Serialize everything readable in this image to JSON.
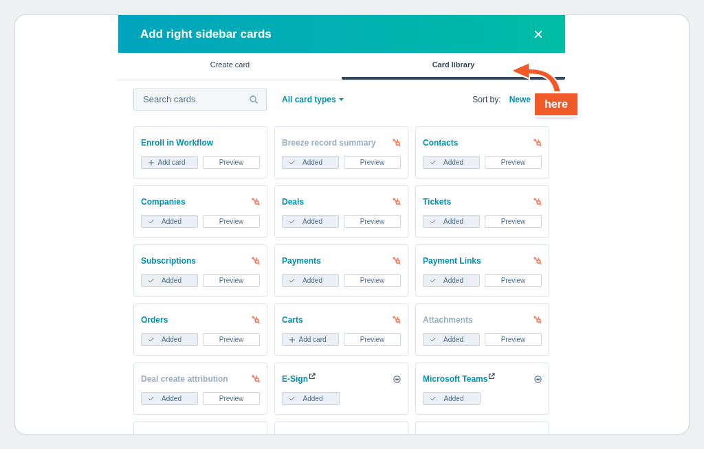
{
  "dialog": {
    "title": "Add right sidebar cards",
    "close": "×"
  },
  "tabs": [
    {
      "label": "Create card",
      "selected": false
    },
    {
      "label": "Card library",
      "selected": true
    }
  ],
  "search": {
    "placeholder": "Search cards"
  },
  "filter": {
    "label": "All card types"
  },
  "sort": {
    "label": "Sort by:",
    "value": "Newe"
  },
  "cards": [
    {
      "kind": "full",
      "title": "Enroll in Workflow",
      "dimmed": false,
      "external": false,
      "action": {
        "kind": "add",
        "label": "Add card"
      },
      "preview": "Preview"
    },
    {
      "kind": "full",
      "title": "Breeze record summary",
      "dimmed": true,
      "badge": {
        "kind": "sprocket"
      },
      "external": false,
      "action": {
        "kind": "added",
        "label": "Added"
      },
      "preview": "Preview"
    },
    {
      "kind": "full",
      "title": "Contacts",
      "dimmed": false,
      "badge": {
        "kind": "sprocket"
      },
      "external": false,
      "action": {
        "kind": "added",
        "label": "Added"
      },
      "preview": "Preview"
    },
    {
      "kind": "full",
      "title": "Companies",
      "dimmed": false,
      "badge": {
        "kind": "sprocket"
      },
      "external": false,
      "action": {
        "kind": "added",
        "label": "Added"
      },
      "preview": "Preview"
    },
    {
      "kind": "full",
      "title": "Deals",
      "dimmed": false,
      "badge": {
        "kind": "sprocket"
      },
      "external": false,
      "action": {
        "kind": "added",
        "label": "Added"
      },
      "preview": "Preview"
    },
    {
      "kind": "full",
      "title": "Tickets",
      "dimmed": false,
      "badge": {
        "kind": "sprocket"
      },
      "external": false,
      "action": {
        "kind": "added",
        "label": "Added"
      },
      "preview": "Preview"
    },
    {
      "kind": "full",
      "title": "Subscriptions",
      "dimmed": false,
      "badge": {
        "kind": "sprocket"
      },
      "external": false,
      "action": {
        "kind": "added",
        "label": "Added"
      },
      "preview": "Preview"
    },
    {
      "kind": "full",
      "title": "Payments",
      "dimmed": false,
      "badge": {
        "kind": "sprocket"
      },
      "external": false,
      "action": {
        "kind": "added",
        "label": "Added"
      },
      "preview": "Preview"
    },
    {
      "kind": "full",
      "title": "Payment Links",
      "dimmed": false,
      "badge": {
        "kind": "sprocket"
      },
      "external": false,
      "action": {
        "kind": "added",
        "label": "Added"
      },
      "preview": "Preview"
    },
    {
      "kind": "full",
      "title": "Orders",
      "dimmed": false,
      "badge": {
        "kind": "sprocket"
      },
      "external": false,
      "action": {
        "kind": "added",
        "label": "Added"
      },
      "preview": "Preview"
    },
    {
      "kind": "full",
      "title": "Carts",
      "dimmed": false,
      "badge": {
        "kind": "sprocket"
      },
      "external": false,
      "action": {
        "kind": "add",
        "label": "Add card"
      },
      "preview": "Preview"
    },
    {
      "kind": "full",
      "title": "Attachments",
      "dimmed": true,
      "badge": {
        "kind": "sprocket"
      },
      "external": false,
      "action": {
        "kind": "added",
        "label": "Added"
      },
      "preview": "Preview"
    },
    {
      "kind": "full",
      "title": "Deal create attribution",
      "dimmed": true,
      "badge": {
        "kind": "sprocket"
      },
      "external": false,
      "action": {
        "kind": "added",
        "label": "Added"
      },
      "preview": "Preview"
    },
    {
      "kind": "full",
      "title": "E-Sign",
      "dimmed": false,
      "badge": {
        "kind": "app"
      },
      "external": true,
      "action": {
        "kind": "added",
        "label": "Added"
      }
    },
    {
      "kind": "full",
      "title": "Microsoft Teams",
      "dimmed": false,
      "badge": {
        "kind": "app"
      },
      "external": true,
      "action": {
        "kind": "added",
        "label": "Added"
      }
    },
    {
      "kind": "cut_off"
    },
    {
      "kind": "cut_off"
    },
    {
      "kind": "cut_off"
    }
  ],
  "callout": {
    "label": "here"
  }
}
